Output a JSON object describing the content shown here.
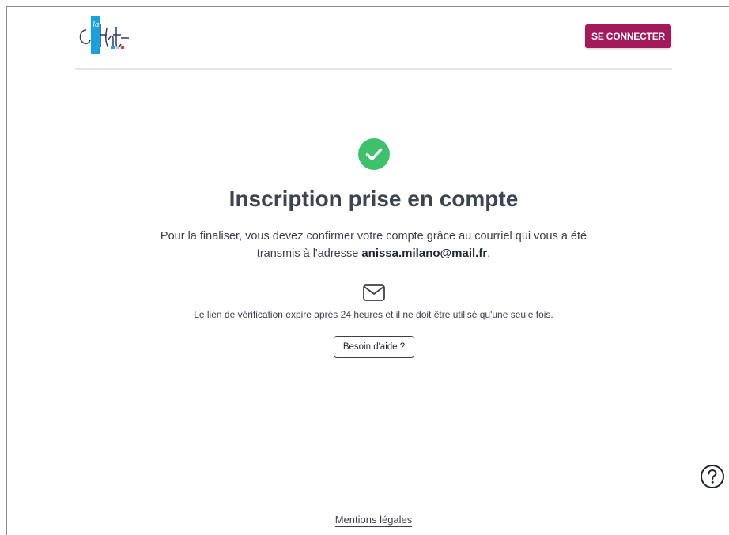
{
  "header": {
    "logo_alt": "La CNFPT",
    "login_label": "SE CONNECTER"
  },
  "main": {
    "title": "Inscription prise en compte",
    "description_before": "Pour la finaliser, vous devez confirmer votre compte grâce au courriel qui vous a été transmis à l'adresse ",
    "email": "anissa.milano@mail.fr",
    "description_after": ".",
    "expiry_notice": "Le lien de vérification expire après 24 heures et il ne doit être utilisé qu'une seule fois.",
    "help_label": "Besoin d'aide ?"
  },
  "footer": {
    "legal_label": "Mentions légales"
  },
  "icons": {
    "success": "check-circle-icon",
    "mail": "envelope-icon",
    "help": "question-circle-icon"
  },
  "colors": {
    "brand": "#a3195b",
    "success": "#3ec16c",
    "logo_blue": "#1aa0dc"
  }
}
